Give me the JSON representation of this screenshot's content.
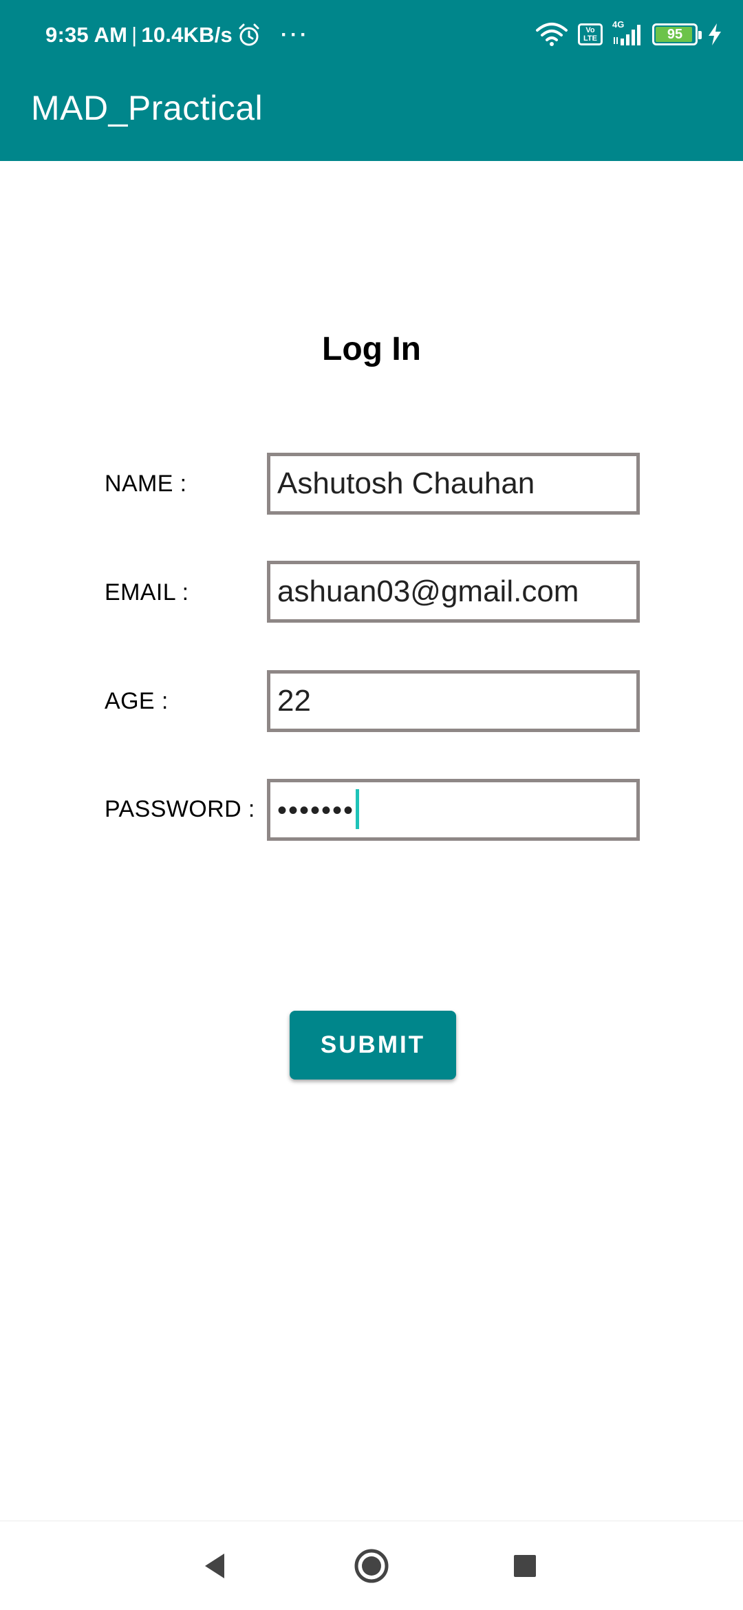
{
  "status_bar": {
    "time": "9:35 AM",
    "separator": "|",
    "network_speed": "10.4KB/s",
    "alarm_icon": "alarm-clock-icon",
    "more_icon": "more-dots-icon",
    "dots": "···",
    "wifi_icon": "wifi-icon",
    "volte_label": "Vo LTE",
    "network_type": "4G",
    "signal_icon": "cell-signal-icon",
    "battery_level": "95",
    "charging_icon": "lightning-bolt-icon"
  },
  "app_bar": {
    "title": "MAD_Practical"
  },
  "form": {
    "title": "Log In",
    "fields": [
      {
        "label": "NAME :",
        "value": "Ashutosh Chauhan"
      },
      {
        "label": "EMAIL :",
        "value": "ashuan03@gmail.com"
      },
      {
        "label": "AGE :",
        "value": "22"
      },
      {
        "label": "PASSWORD :",
        "value": "•••••••"
      }
    ],
    "submit_label": "SUBMIT"
  },
  "nav_bar": {
    "back_icon": "back-triangle-icon",
    "home_icon": "home-circle-icon",
    "recents_icon": "recents-square-icon"
  },
  "colors": {
    "primary": "#00868b",
    "input_border": "#8e8786",
    "cursor": "#1ec3b8",
    "battery_fill": "#6cc34a"
  }
}
